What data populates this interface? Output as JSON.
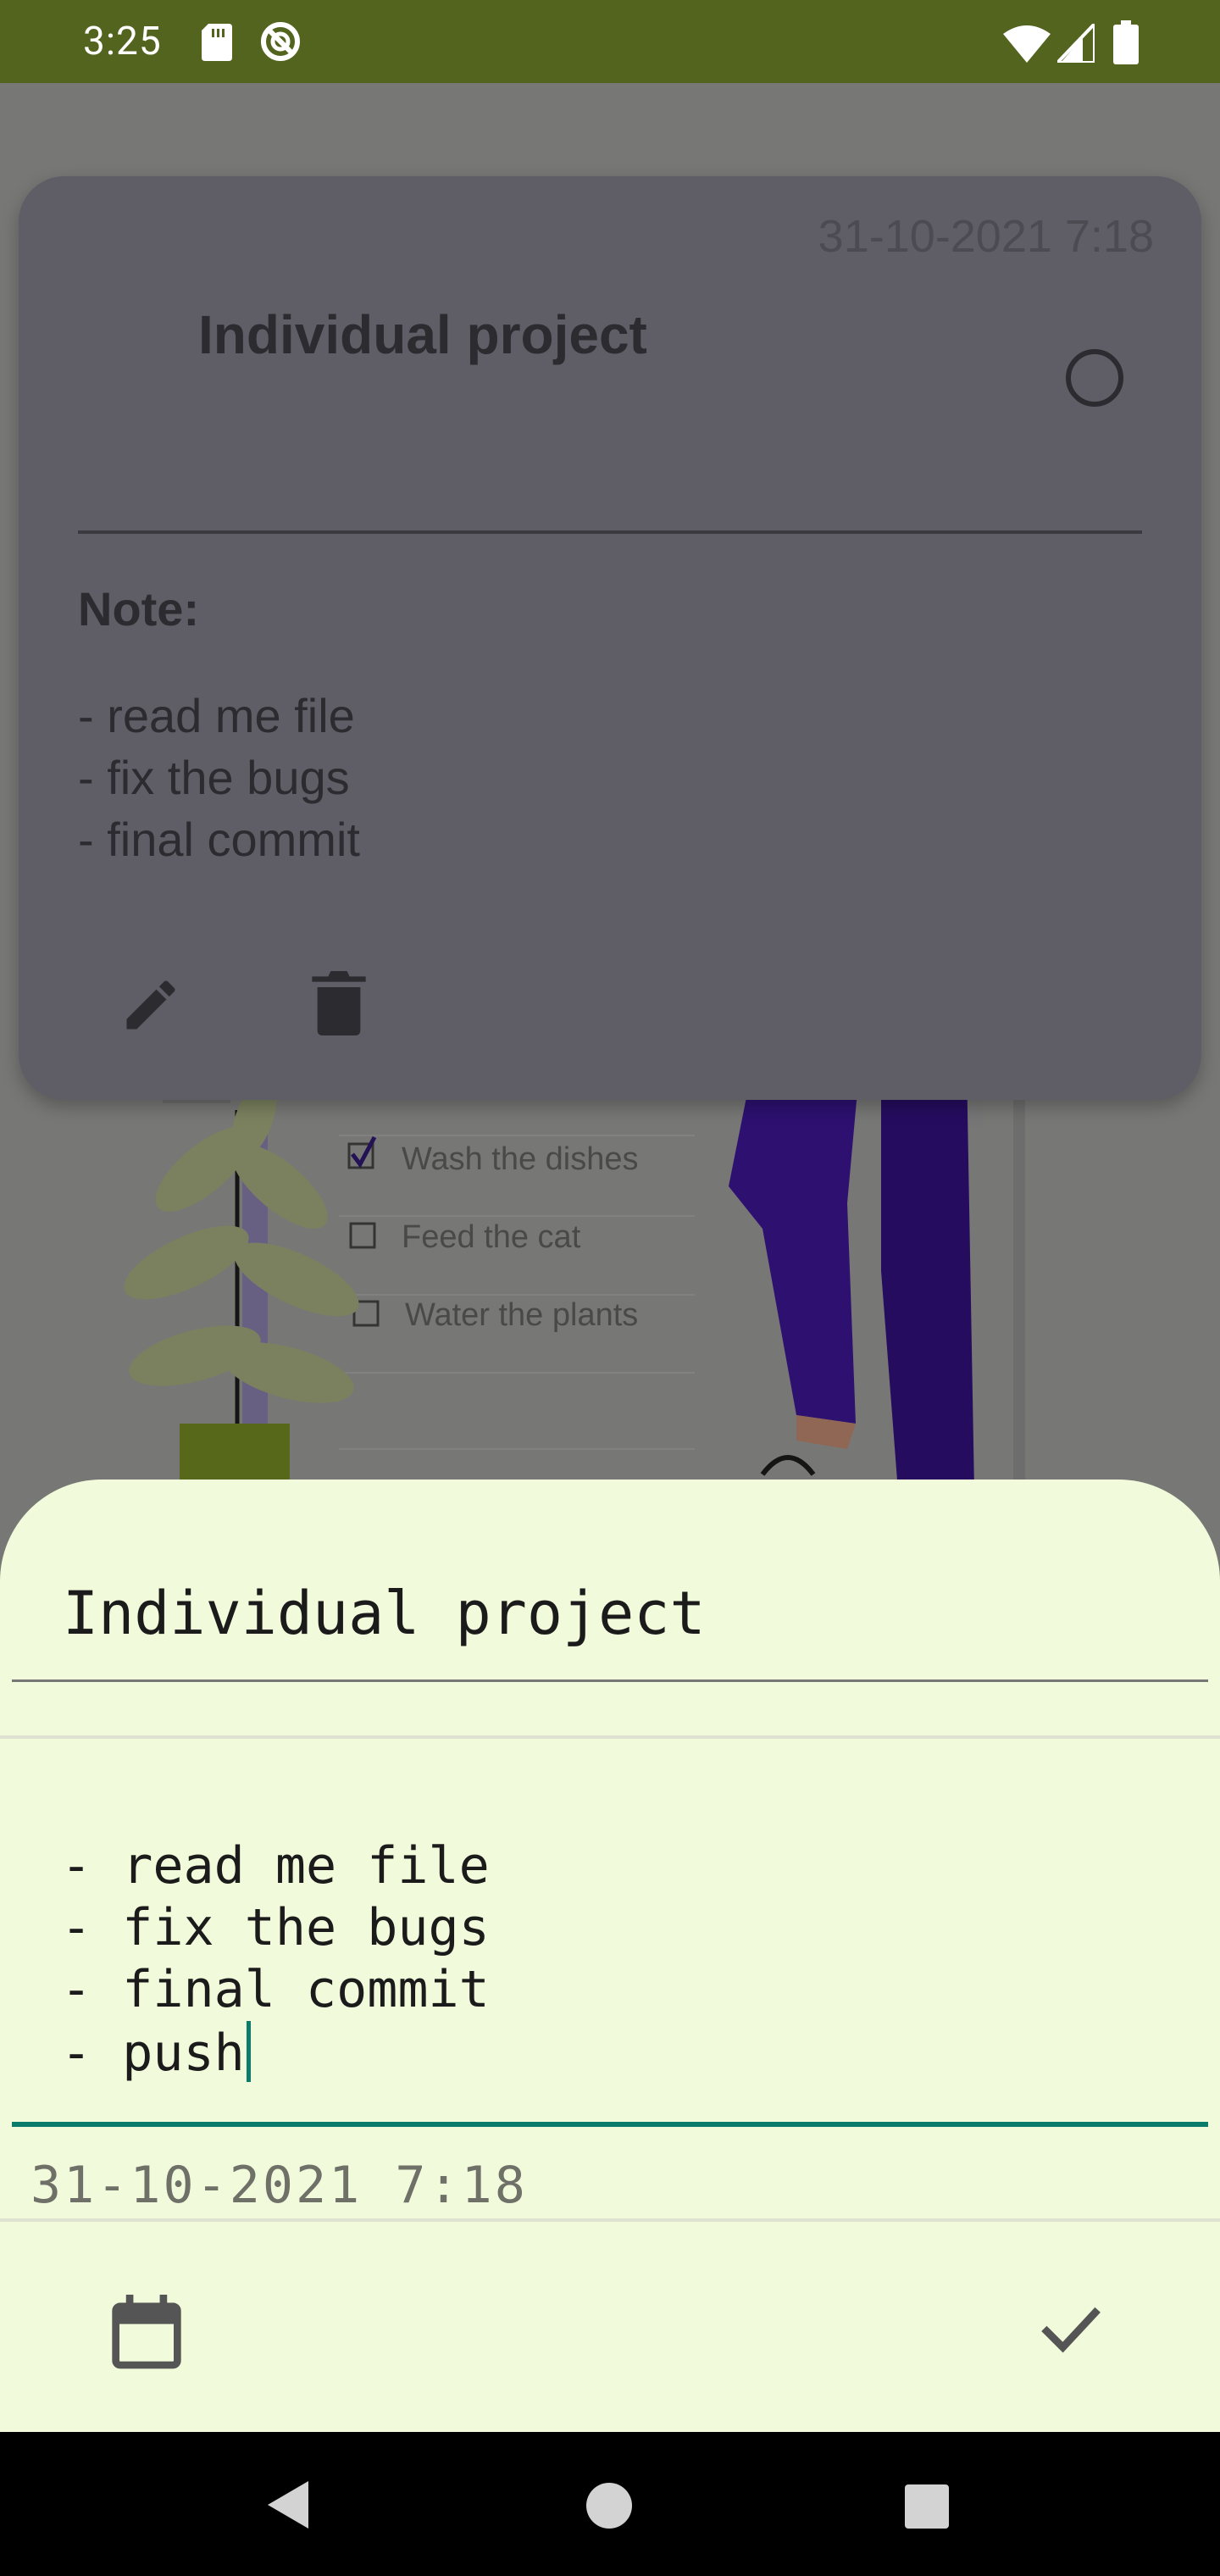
{
  "status_bar": {
    "time": "3:25",
    "icons": [
      "sd-card-icon",
      "sync-ring-icon",
      "wifi-icon",
      "signal-icon",
      "battery-icon"
    ]
  },
  "card": {
    "date": "31-10-2021 7:18",
    "title": "Individual project",
    "note_label": "Note:",
    "note_text": "- read me file\n- fix the bugs\n- final commit",
    "actions": [
      "edit-icon",
      "trash-icon"
    ]
  },
  "illustration": {
    "checklist": [
      "Wash the dishes",
      "Feed the cat",
      "Water the plants"
    ]
  },
  "sheet": {
    "title_value": "Individual project",
    "note_value": "- read me file\n- fix the bugs\n- final commit\n- push",
    "date_value": "31-10-2021 7:18",
    "buttons": [
      "calendar-icon",
      "check-icon"
    ]
  },
  "nav": [
    "back-icon",
    "home-icon",
    "recents-icon"
  ],
  "colors": {
    "status_bar": "#53641f",
    "sheet_bg": "#f1fbdb",
    "accent": "#0b7b6b",
    "card_bg": "#5f5d66"
  }
}
